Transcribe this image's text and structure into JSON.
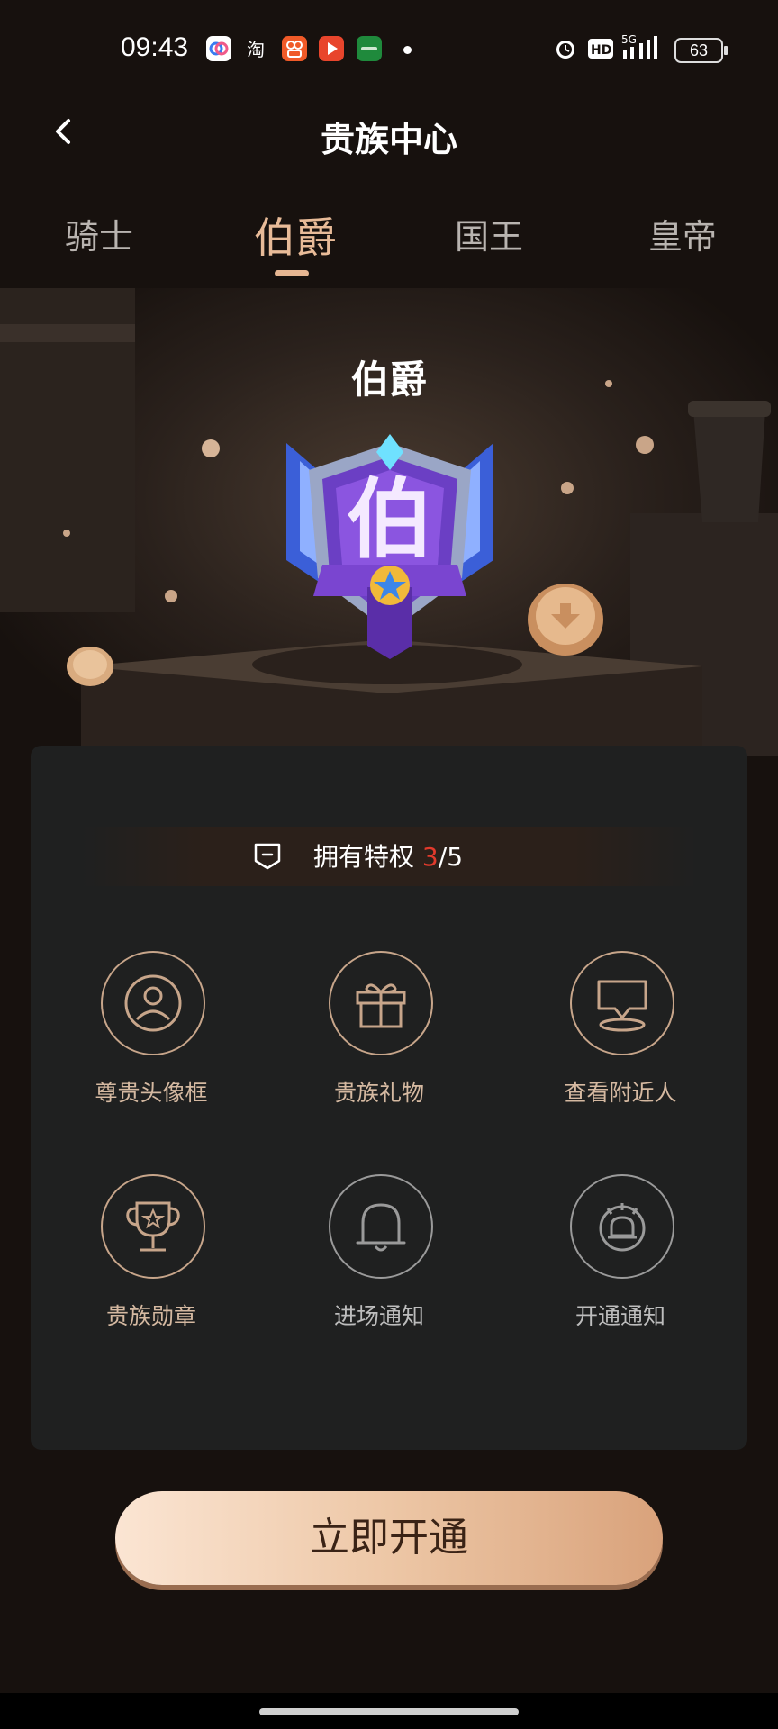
{
  "status_bar": {
    "time": "09:43",
    "battery": "63"
  },
  "header": {
    "title": "贵族中心"
  },
  "tabs": [
    {
      "label": "骑士",
      "active": false
    },
    {
      "label": "伯爵",
      "active": true
    },
    {
      "label": "国王",
      "active": false
    },
    {
      "label": "皇帝",
      "active": false
    }
  ],
  "hero": {
    "rank_title": "伯爵",
    "badge_char": "伯"
  },
  "privileges": {
    "label": "拥有特权",
    "owned": "3",
    "separator": "/",
    "total": "5",
    "items": [
      {
        "label": "尊贵头像框",
        "icon": "avatar-frame-icon",
        "owned": true
      },
      {
        "label": "贵族礼物",
        "icon": "gift-icon",
        "owned": true
      },
      {
        "label": "查看附近人",
        "icon": "nearby-people-icon",
        "owned": true
      },
      {
        "label": "贵族勋章",
        "icon": "trophy-icon",
        "owned": true
      },
      {
        "label": "进场通知",
        "icon": "bell-icon",
        "owned": false
      },
      {
        "label": "开通通知",
        "icon": "lamp-icon",
        "owned": false
      }
    ]
  },
  "cta": {
    "label": "立即开通"
  },
  "colors": {
    "accent": "#e8bb98",
    "highlight_red": "#e23a2c",
    "button_start": "#fbe5d3",
    "button_end": "#d9a27b"
  }
}
